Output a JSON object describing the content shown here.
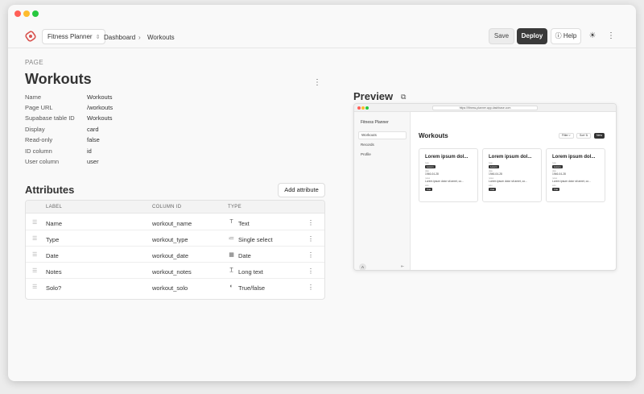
{
  "app": {
    "project_name": "Fitness Planner",
    "breadcrumb": [
      "Dashboard",
      "Workouts"
    ],
    "actions": {
      "save": "Save",
      "deploy": "Deploy",
      "help": "Help"
    }
  },
  "page": {
    "section_label": "PAGE",
    "title": "Workouts",
    "properties": [
      {
        "key": "Name",
        "value": "Workouts"
      },
      {
        "key": "Page URL",
        "value": "/workouts"
      },
      {
        "key": "Supabase table ID",
        "value": "Workouts"
      },
      {
        "key": "Display",
        "value": "card"
      },
      {
        "key": "Read-only",
        "value": "false"
      },
      {
        "key": "ID column",
        "value": "id"
      },
      {
        "key": "User column",
        "value": "user"
      }
    ]
  },
  "attributes": {
    "title": "Attributes",
    "add_button": "Add attribute",
    "columns": [
      "LABEL",
      "COLUMN ID",
      "TYPE"
    ],
    "rows": [
      {
        "label": "Name",
        "column_id": "workout_name",
        "type": "Text",
        "type_icon": "text-icon"
      },
      {
        "label": "Type",
        "column_id": "workout_type",
        "type": "Single select",
        "type_icon": "list-icon"
      },
      {
        "label": "Date",
        "column_id": "workout_date",
        "type": "Date",
        "type_icon": "calendar-icon"
      },
      {
        "label": "Notes",
        "column_id": "workout_notes",
        "type": "Long text",
        "type_icon": "long-text-icon"
      },
      {
        "label": "Solo?",
        "column_id": "workout_solo",
        "type": "True/false",
        "type_icon": "toggle-icon"
      }
    ]
  },
  "preview": {
    "title": "Preview",
    "url": "https://fitness-planner.app.dashbase.com",
    "app_name": "Fitness Planner",
    "nav": [
      "Workouts",
      "Records",
      "Profile"
    ],
    "active_nav": "Workouts",
    "avatar": "A",
    "heading": "Workouts",
    "toolbar": [
      "Filter",
      "Sort",
      "New"
    ],
    "cards": [
      {
        "title": "Lorem ipsum dol...",
        "type_label": "type",
        "type_value": "Lorem",
        "date_label": "date",
        "date_value": "1946-04-28",
        "notes_label": "notes",
        "notes_value": "Lorem ipsum dolor sit amet, co...",
        "solo_label": "solo",
        "solo_value": "true"
      },
      {
        "title": "Lorem ipsum dol...",
        "type_label": "type",
        "type_value": "Lorem",
        "date_label": "date",
        "date_value": "1946-04-28",
        "notes_label": "notes",
        "notes_value": "Lorem ipsum dolor sit amet, co...",
        "solo_label": "solo",
        "solo_value": "true"
      },
      {
        "title": "Lorem ipsum dol...",
        "type_label": "type",
        "type_value": "Lorem",
        "date_label": "date",
        "date_value": "1946-04-28",
        "notes_label": "notes",
        "notes_value": "Lorem ipsum dolor sit amet, co...",
        "solo_label": "solo",
        "solo_value": "true"
      }
    ]
  }
}
